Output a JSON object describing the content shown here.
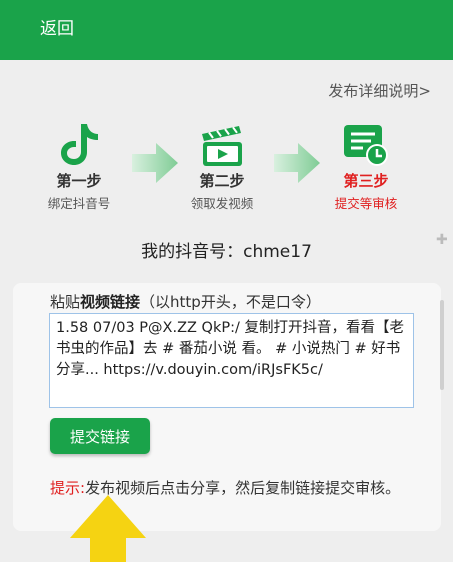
{
  "header": {
    "back_label": "返回",
    "background": "#1aa34a"
  },
  "detail_link": "发布详细说明>",
  "steps": [
    {
      "title": "第一步",
      "subtitle": "绑定抖音号",
      "icon": "tiktok-note-icon",
      "active": false
    },
    {
      "title": "第二步",
      "subtitle": "领取发视频",
      "icon": "video-clapper-icon",
      "active": false
    },
    {
      "title": "第三步",
      "subtitle": "提交等审核",
      "icon": "form-clock-icon",
      "active": true
    }
  ],
  "douyin_id": "我的抖音号：chme17",
  "paste": {
    "label_prefix": "粘贴",
    "label_bold": "视频链接",
    "label_suffix": "（以http开头，不是口令）",
    "value": "1.58 07/03 P@X.ZZ QkP:/  复制打开抖音，看看【老书虫的作品】去 # 番茄小说 看。 # 小说热门 # 好书分享... https://v.douyin.com/iRJsFK5c/"
  },
  "submit_label": "提交链接",
  "hint": {
    "prefix": "提示:",
    "text": "发布视频后点击分享，然后复制链接提交审核。"
  },
  "colors": {
    "accent_green": "#1aa34a",
    "active_red": "#e02020",
    "arrow_pointer": "#f5d312"
  }
}
